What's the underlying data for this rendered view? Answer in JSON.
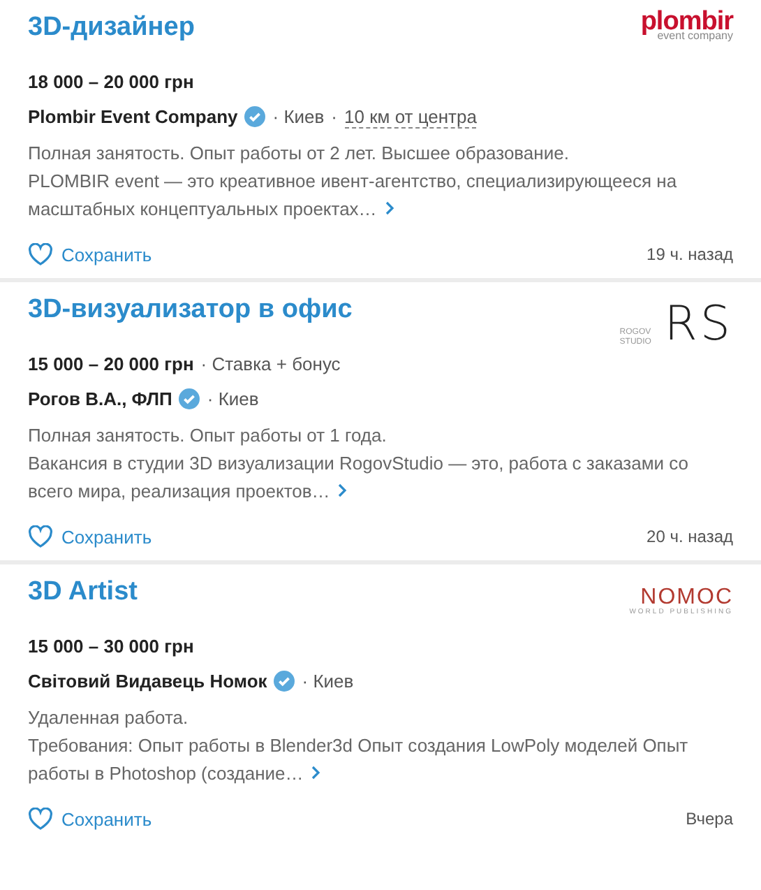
{
  "jobs": [
    {
      "title": "3D-дизайнер",
      "salary": "18 000 – 20 000 грн",
      "company": "Plombir Event Company",
      "verified": true,
      "city": "· Киев",
      "separator": "·",
      "distance": "10 км от центра",
      "summary": "Полная занятость. Опыт работы от 2 лет. Высшее образование.",
      "snippet": "PLOMBIR event — это креативное ивент-агентство, специализирующееся на масштабных концептуальных проектах…",
      "save_label": "Сохранить",
      "time": "19 ч. назад",
      "logo": {
        "kind": "plombir",
        "text": "plombir",
        "subtext": "event company"
      }
    },
    {
      "title": "3D-визуализатор в офис",
      "salary": "15 000 – 20 000 грн",
      "salary_note": "· Ставка + бонус",
      "company": "Рогов В.А., ФЛП",
      "verified": true,
      "city": "· Киев",
      "summary": "Полная занятость. Опыт работы от 1 года.",
      "snippet": "Вакансия в студии 3D визуализации RogovStudio — это, работа с заказами со всего мира, реализация проектов…",
      "save_label": "Сохранить",
      "time": "20 ч. назад",
      "logo": {
        "kind": "rogov",
        "text": "RS",
        "subtext": "ROGOV STUDIO"
      }
    },
    {
      "title": "3D Artist",
      "salary": "15 000 – 30 000 грн",
      "company": "Світовий Видавець Номок",
      "verified": true,
      "city": "· Киев",
      "summary": "Удаленная работа.",
      "snippet": "Требования: Опыт работы в Blender3d Опыт создания LowPoly моделей Опыт работы в Photoshop (создание…",
      "save_label": "Сохранить",
      "time": "Вчера",
      "logo": {
        "kind": "nomoc",
        "text": "NOMOC",
        "subtext": "WORLD PUBLISHING"
      }
    }
  ]
}
